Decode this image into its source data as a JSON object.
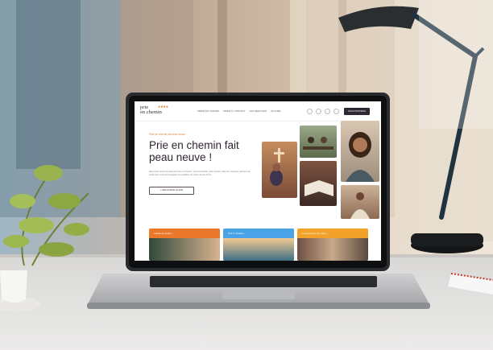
{
  "site": {
    "logo_line1": "prie",
    "logo_line2": "en chemin",
    "nav": [
      "PRIER EN CHEMIN",
      "PRIER À L'INSTANT",
      "LES SERVICES",
      "ACCUEIL"
    ],
    "cta": "NOUS SOUTENIR",
    "kicker": "Prier en chemin fait peau neuve",
    "headline_line1": "Prie en chemin fait",
    "headline_line2": "peau neuve !",
    "body": "Découvrez notre nouveau site Prie en Chemin : plus accessible, plus complet, avec de nouveaux parcours de prière pour vous accompagner au quotidien sur votre chemin de foi.",
    "button": "+ DÉCOUVRIR LE SITE",
    "tiles": [
      {
        "label": "Laisse-toi guider  ›",
        "color": "#e9782b"
      },
      {
        "label": "Prie à l'instant  ›",
        "color": "#4aa3e6"
      },
      {
        "label": "Les parcours de prière  ›",
        "color": "#f2a22a"
      }
    ]
  }
}
